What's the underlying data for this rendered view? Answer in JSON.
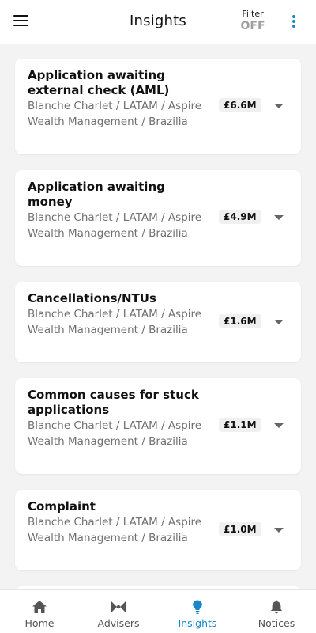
{
  "header": {
    "title": "Insights",
    "filter_label": "Filter",
    "filter_value": "OFF",
    "menu_icon": "hamburger-menu-icon",
    "more_icon": "vertical-dots-icon"
  },
  "colors": {
    "accent": "#1a86c9",
    "background": "#f3f3f3",
    "muted": "#9e9e9e"
  },
  "insights": [
    {
      "title": "Application awaiting external check (AML)",
      "subtitle": "Blanche Charlet / LATAM / Aspire Wealth Management / Brazilia",
      "amount": "£6.6M"
    },
    {
      "title": "Application awaiting money",
      "subtitle": "Blanche Charlet / LATAM / Aspire Wealth Management / Brazilia",
      "amount": "£4.9M"
    },
    {
      "title": "Cancellations/NTUs",
      "subtitle": "Blanche Charlet / LATAM / Aspire Wealth Management / Brazilia",
      "amount": "£1.6M"
    },
    {
      "title": "Common causes for stuck applications",
      "subtitle": "Blanche Charlet / LATAM / Aspire Wealth Management / Brazilia",
      "amount": "£1.1M"
    },
    {
      "title": "Complaint",
      "subtitle": "Blanche Charlet / LATAM / Aspire Wealth Management / Brazilia",
      "amount": "£1.0M"
    }
  ],
  "tabs": [
    {
      "label": "Home",
      "icon": "home-icon",
      "active": false
    },
    {
      "label": "Advisers",
      "icon": "advisers-icon",
      "active": false
    },
    {
      "label": "Insights",
      "icon": "lightbulb-icon",
      "active": true
    },
    {
      "label": "Notices",
      "icon": "bell-icon",
      "active": false
    }
  ]
}
